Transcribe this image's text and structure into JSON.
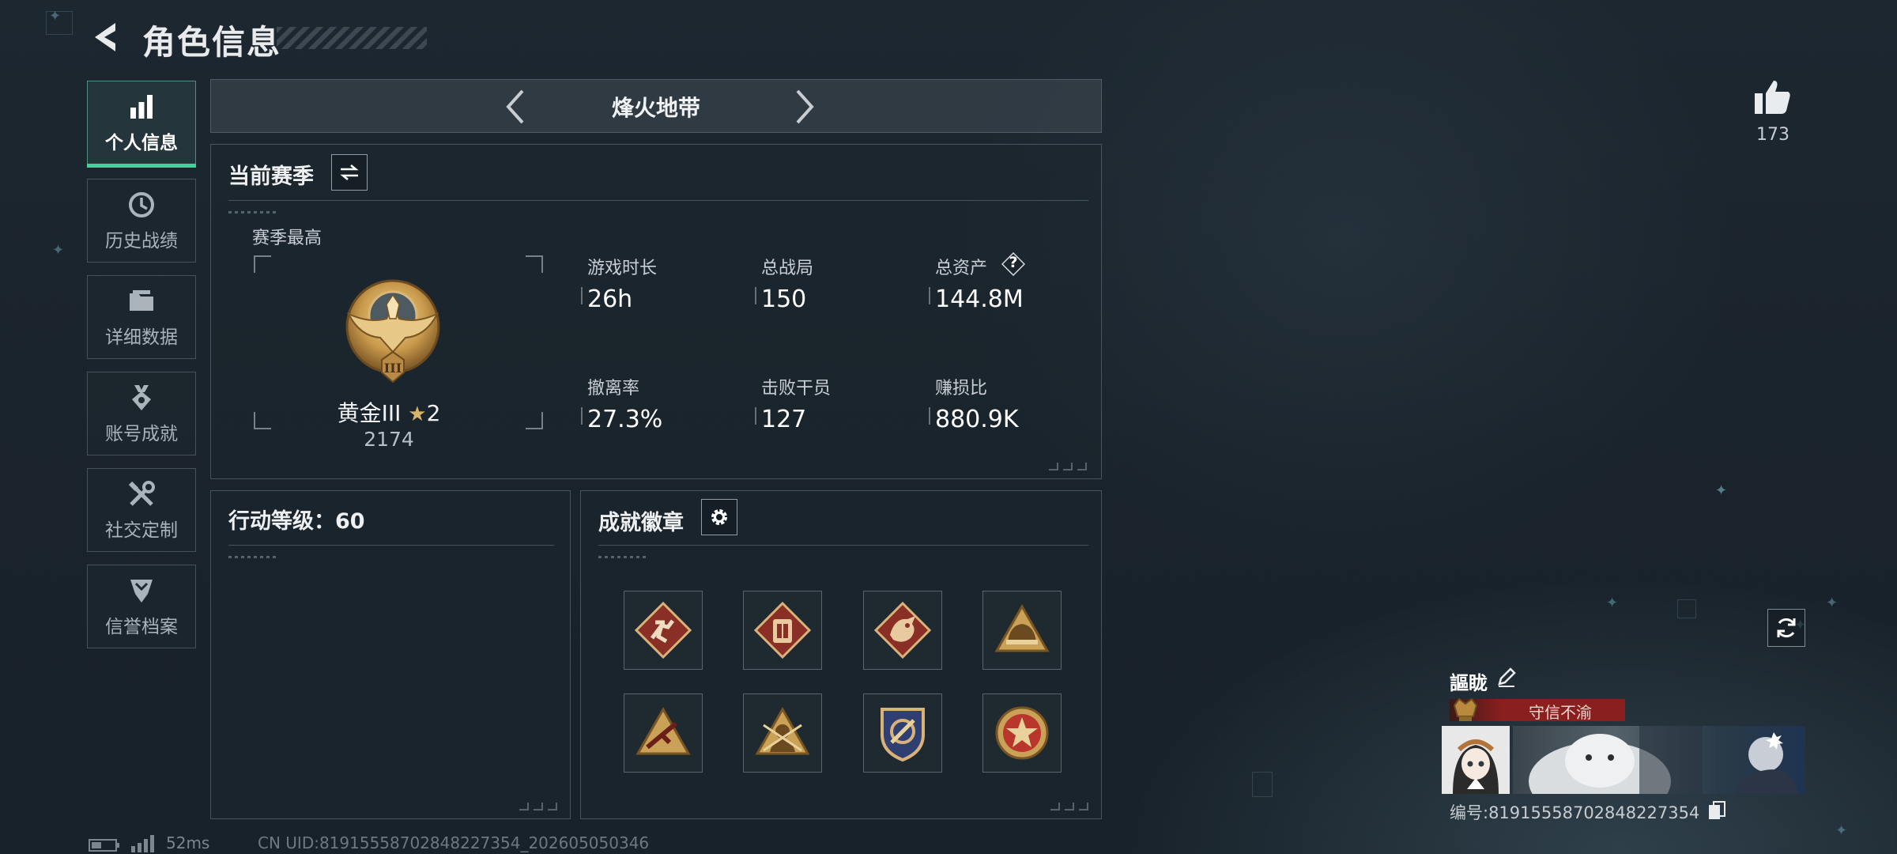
{
  "header": {
    "title": "角色信息"
  },
  "sidebar": {
    "items": [
      {
        "label": "个人信息",
        "icon": "bar-chart-icon",
        "active": true
      },
      {
        "label": "历史战绩",
        "icon": "history-clock-icon",
        "active": false
      },
      {
        "label": "详细数据",
        "icon": "folder-icon",
        "active": false
      },
      {
        "label": "账号成就",
        "icon": "achievement-badge-icon",
        "active": false
      },
      {
        "label": "社交定制",
        "icon": "tools-icon",
        "active": false
      },
      {
        "label": "信誉档案",
        "icon": "shield-chevron-icon",
        "active": false
      }
    ]
  },
  "mode": {
    "title": "烽火地带"
  },
  "season": {
    "title": "当前赛季",
    "best_label": "赛季最高",
    "rank_name": "黄金III",
    "rank_stars": "2",
    "rank_score": "2174",
    "rank_emblem_numeral": "III",
    "stats": [
      {
        "label": "游戏时长",
        "value": "26h"
      },
      {
        "label": "总战局",
        "value": "150"
      },
      {
        "label": "总资产",
        "value": "144.8M",
        "help": "?"
      },
      {
        "label": "撤离率",
        "value": "27.3%"
      },
      {
        "label": "击败干员",
        "value": "127"
      },
      {
        "label": "赚损比",
        "value": "880.9K"
      }
    ]
  },
  "level": {
    "title": "行动等级：60"
  },
  "badges": {
    "title": "成就徽章",
    "items": [
      {
        "icon": "runner-badge-icon",
        "color": "#8a2f26"
      },
      {
        "icon": "gear-vest-badge-icon",
        "color": "#8a2f26"
      },
      {
        "icon": "dragon-badge-icon",
        "color": "#8a2f26"
      },
      {
        "icon": "helmet-triangle-badge-icon",
        "color": "#c9a050"
      },
      {
        "icon": "rifle-triangle-badge-icon",
        "color": "#c9a050"
      },
      {
        "icon": "soldier-triangle-badge-icon",
        "color": "#c9a050"
      },
      {
        "icon": "shield-crest-badge-icon",
        "color": "#2f3f72"
      },
      {
        "icon": "star-medal-badge-icon",
        "color": "#b8362c"
      }
    ]
  },
  "likes": {
    "count": "173"
  },
  "profile": {
    "name": "謳眬",
    "title_tag": "守信不渝",
    "id_text": "编号:8191555870284822735​4"
  },
  "footer": {
    "ping": "52ms",
    "uid": "CN UID:8191555870284822735​4_202605050346"
  },
  "colors": {
    "accent": "#3fd39a",
    "title_tag_bg": "#7a1c1c"
  }
}
